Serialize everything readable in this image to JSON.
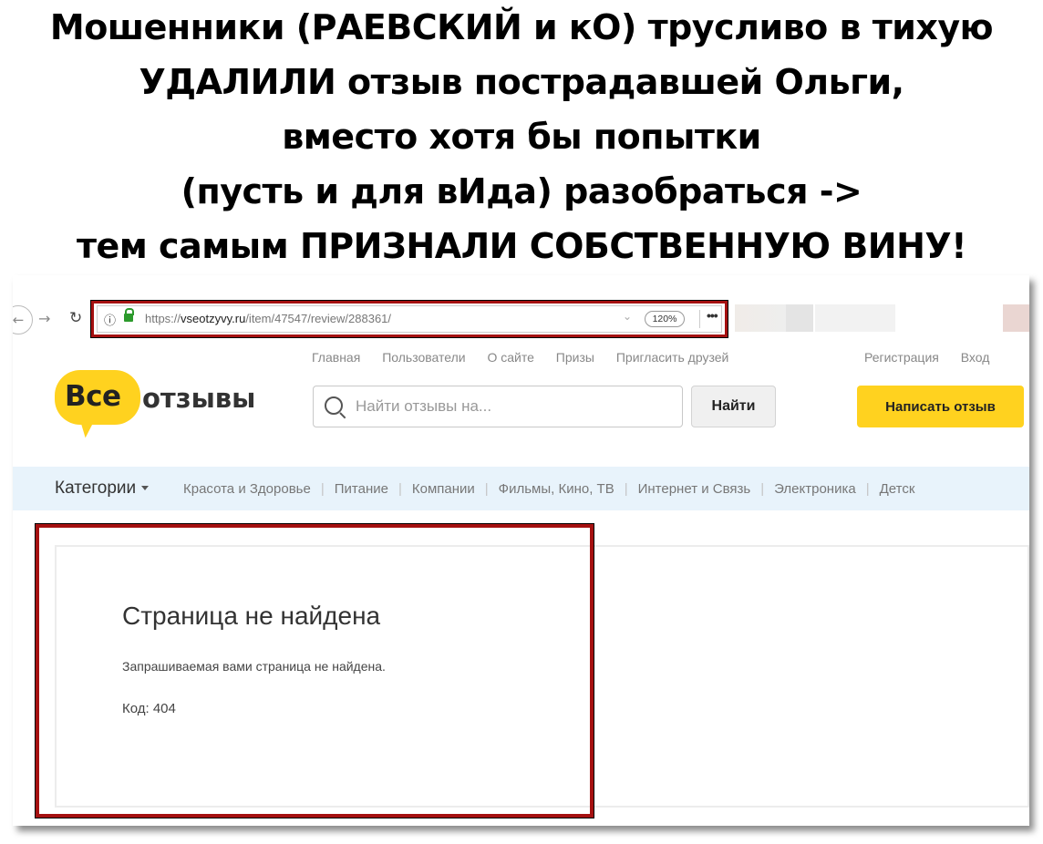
{
  "headline": {
    "line1": "Мошенники (РАЕВСКИЙ и кО) трусливо в тихую",
    "line2": "УДАЛИЛИ отзыв пострадавшей Ольги,",
    "line3": "вместо хотя бы попытки",
    "line4": "(пусть и для вИда) разобраться ->",
    "line5": "тем самым ПРИЗНАЛИ СОБСТВЕННУЮ ВИНУ!"
  },
  "browser": {
    "url_prefix": "https://",
    "url_host": "vseotzyvy.ru",
    "url_path": "/item/47547/review/288361/",
    "zoom": "120%",
    "more": "•••",
    "info_icon": "info-icon",
    "lock_icon": "lock-icon"
  },
  "site": {
    "topnav": [
      "Главная",
      "Пользователи",
      "О сайте",
      "Призы",
      "Пригласить друзей"
    ],
    "authnav": [
      "Регистрация",
      "Вход"
    ],
    "logo_part1": "Все",
    "logo_part2": "отзывы",
    "search_placeholder": "Найти отзывы на...",
    "search_button": "Найти",
    "write_button": "Написать отзыв",
    "categories_label": "Категории",
    "categories": [
      "Красота и Здоровье",
      "Питание",
      "Компании",
      "Фильмы, Кино, ТВ",
      "Интернет и Связь",
      "Электроника",
      "Детск"
    ]
  },
  "error": {
    "title": "Страница не найдена",
    "description": "Запрашиваемая вами страница не найдена.",
    "code": "Код: 404"
  },
  "colors": {
    "highlight_red": "#a51010",
    "brand_yellow": "#ffd21f",
    "category_bar": "#e8f3fb"
  }
}
